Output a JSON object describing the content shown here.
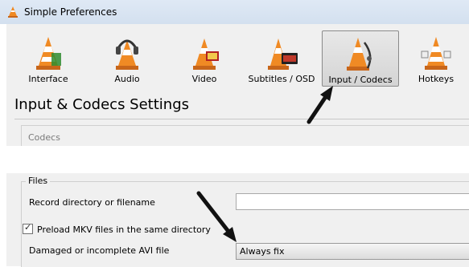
{
  "window": {
    "title": "Simple Preferences",
    "icon": "vlc-cone-icon"
  },
  "toolbar": {
    "items": [
      {
        "label": "Interface",
        "icon": "interface-icon",
        "active": false
      },
      {
        "label": "Audio",
        "icon": "audio-icon",
        "active": false
      },
      {
        "label": "Video",
        "icon": "video-icon",
        "active": false
      },
      {
        "label": "Subtitles / OSD",
        "icon": "subtitles-icon",
        "active": false
      },
      {
        "label": "Input / Codecs",
        "icon": "input-codecs-icon",
        "active": true
      },
      {
        "label": "Hotkeys",
        "icon": "hotkeys-icon",
        "active": false
      }
    ]
  },
  "main": {
    "title": "Input & Codecs Settings",
    "codecs_group_label": "Codecs",
    "files_group": {
      "label": "Files",
      "record_label": "Record directory or filename",
      "record_value": "",
      "preload_mkv_label": "Preload MKV files in the same directory",
      "preload_mkv_checked": true,
      "damaged_avi_label": "Damaged or incomplete AVI file",
      "damaged_avi_value": "Always fix"
    }
  },
  "colors": {
    "cone_orange": "#f08a24",
    "cone_white": "#ffffff",
    "selected_bg": "#d8d8d8",
    "arrow": "#111111"
  }
}
